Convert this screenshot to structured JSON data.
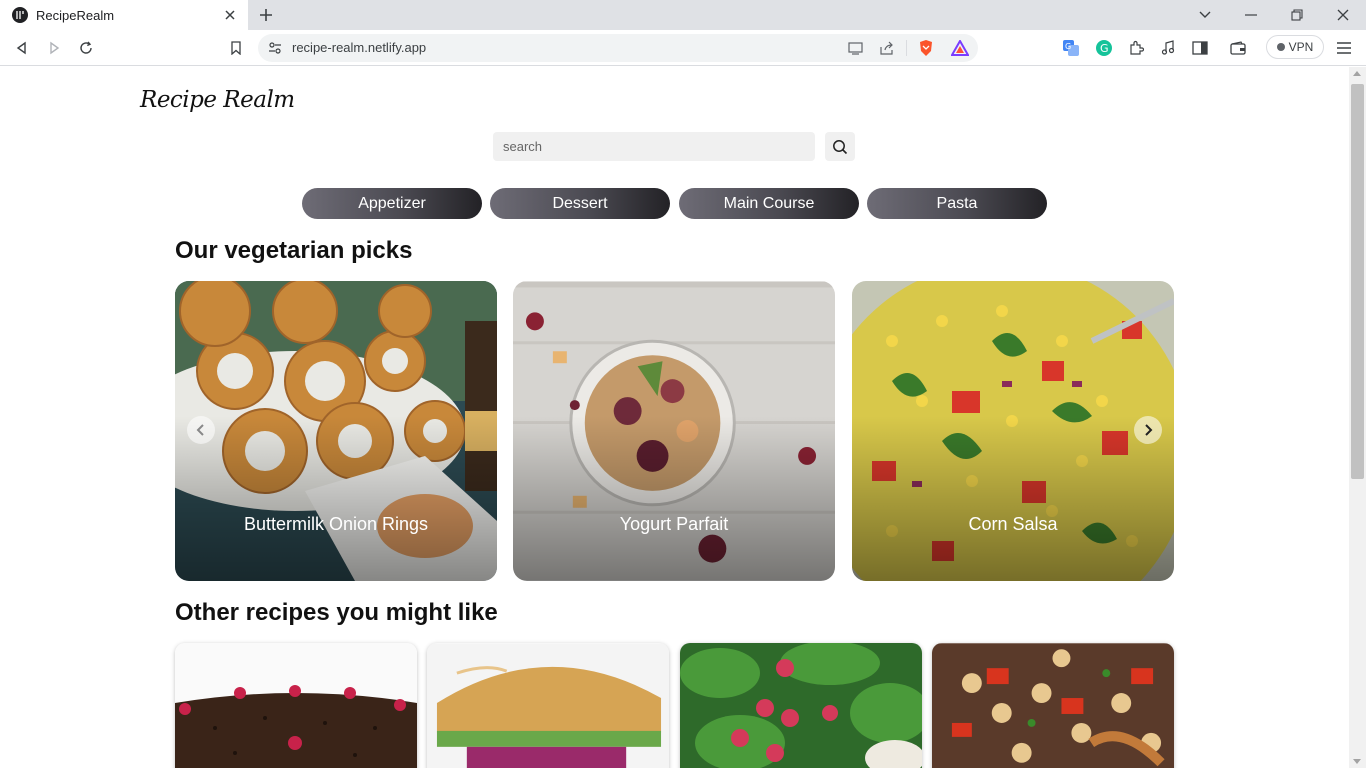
{
  "browser": {
    "tab_title": "RecipeRealm",
    "url": "recipe-realm.netlify.app",
    "vpn_label": "VPN"
  },
  "site": {
    "logo": "Recipe Realm",
    "search_placeholder": "search"
  },
  "categories": [
    "Appetizer",
    "Dessert",
    "Main Course",
    "Pasta"
  ],
  "veggie_section": {
    "title": "Our vegetarian picks",
    "cards": [
      {
        "label": "Buttermilk Onion Rings"
      },
      {
        "label": "Yogurt Parfait"
      },
      {
        "label": "Corn Salsa"
      }
    ]
  },
  "other_section": {
    "title": "Other recipes you might like"
  },
  "colors": {
    "chip_gradient_start": "#6e6c76",
    "chip_gradient_end": "#232226"
  }
}
